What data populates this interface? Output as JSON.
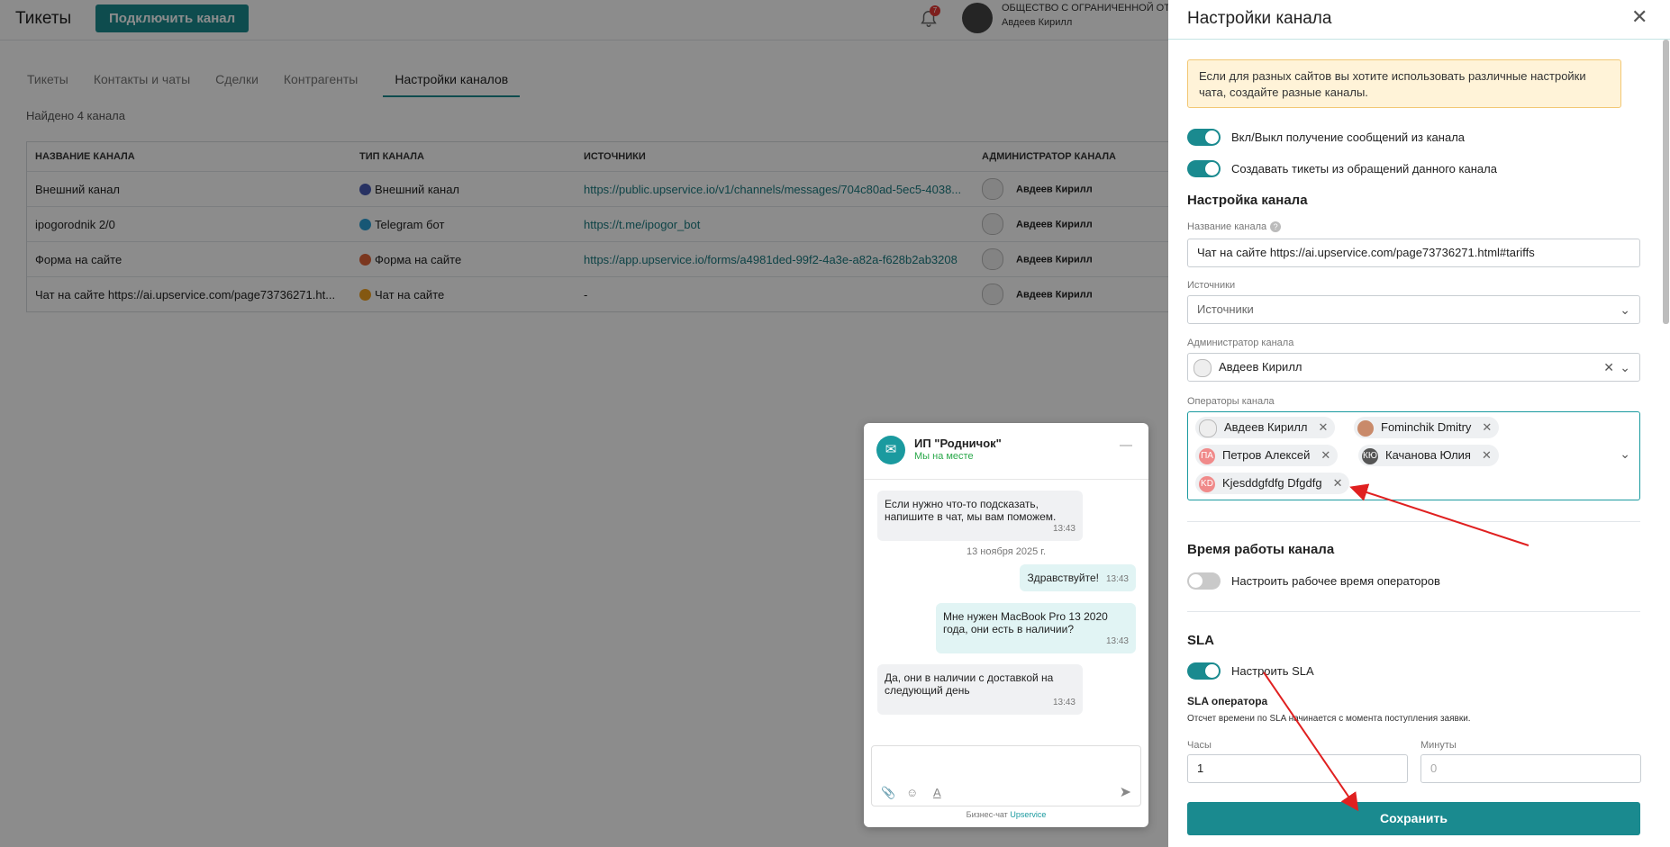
{
  "header": {
    "title": "Тикеты",
    "connect_button": "Подключить канал",
    "notifications_count": "7",
    "org_name": "ОБЩЕСТВО С ОГРАНИЧЕННОЙ ОТВ",
    "user_name": "Авдеев Кирилл"
  },
  "tabs": [
    "Тикеты",
    "Контакты и чаты",
    "Сделки",
    "Контрагенты",
    "Настройки каналов"
  ],
  "found_text": "Найдено 4 канала",
  "table": {
    "headers": [
      "НАЗВАНИЕ КАНАЛА",
      "ТИП КАНАЛА",
      "ИСТОЧНИКИ",
      "АДМИНИСТРАТОР КАНАЛА"
    ],
    "rows": [
      {
        "name": "Внешний канал",
        "type": "Внешний канал",
        "type_color": "#4a5bb5",
        "source": "https://public.upservice.io/v1/channels/messages/704c80ad-5ec5-4038...",
        "admin": "Авдеев Кирилл"
      },
      {
        "name": "ipogorodnik 2/0",
        "type": "Telegram бот",
        "type_color": "#2a9fd6",
        "source": "https://t.me/ipogor_bot",
        "admin": "Авдеев Кирилл"
      },
      {
        "name": "Форма на сайте",
        "type": "Форма на сайте",
        "type_color": "#e0643a",
        "source": "https://app.upservice.io/forms/a4981ded-99f2-4a3e-a82a-f628b2ab3208",
        "admin": "Авдеев Кирилл"
      },
      {
        "name": "Чат на сайте https://ai.upservice.com/page73736271.ht...",
        "type": "Чат на сайте",
        "type_color": "#f0a020",
        "source": "-",
        "admin": "Авдеев Кирилл"
      }
    ]
  },
  "widget": {
    "company": "ИП \"Родничок\"",
    "status": "Мы на месте",
    "messages": [
      {
        "text": "Если нужно что-то подсказать, напишите в чат, мы вам поможем.",
        "time": "13:43"
      },
      {
        "text": "Здравствуйте!",
        "time": "13:43"
      },
      {
        "text": "Мне нужен MacBook Pro 13 2020 года, они есть в наличии?",
        "time": "13:43"
      },
      {
        "text": "Да, они в наличии с доставкой на следующий день",
        "time": "13:43"
      }
    ],
    "date": "13 ноября 2025 г.",
    "footer_prefix": "Бизнес-чат",
    "footer_brand": "Upservice"
  },
  "panel": {
    "title": "Настройки канала",
    "warning": "Если для разных сайтов вы хотите использовать различные настройки чата, создайте разные каналы.",
    "toggle_receive": "Вкл/Выкл получение сообщений из канала",
    "toggle_tickets": "Создавать тикеты из обращений данного канала",
    "section_settings": "Настройка канала",
    "label_name": "Название канала",
    "channel_name": "Чат на сайте https://ai.upservice.com/page73736271.html#tariffs",
    "label_sources": "Источники",
    "sources_placeholder": "Источники",
    "label_admin": "Администратор канала",
    "admin_value": "Авдеев Кирилл",
    "label_operators": "Операторы канала",
    "operators": [
      {
        "name": "Авдеев Кирилл",
        "initials": "",
        "color": "#eeeeee"
      },
      {
        "name": "Fominchik Dmitry",
        "initials": "",
        "color": "#c98a6a"
      },
      {
        "name": "Петров Алексей",
        "initials": "ПА",
        "color": "#f08a8a"
      },
      {
        "name": "Качанова Юлия",
        "initials": "КЮ",
        "color": "#555555"
      },
      {
        "name": "Kjesddgfdfg Dfgdfg",
        "initials": "KD",
        "color": "#f08a8a"
      }
    ],
    "section_hours": "Время работы канала",
    "toggle_hours": "Настроить рабочее время операторов",
    "section_sla": "SLA",
    "toggle_sla": "Настроить SLA",
    "sla_operator": "SLA оператора",
    "sla_note": "Отсчет времени по SLA начинается с момента поступления заявки.",
    "label_hours": "Часы",
    "hours_value": "1",
    "label_minutes": "Минуты",
    "minutes_placeholder": "0",
    "save": "Сохранить"
  },
  "colors": {
    "accent": "#1a8a8f",
    "annotation_arrow": "#e02020"
  }
}
